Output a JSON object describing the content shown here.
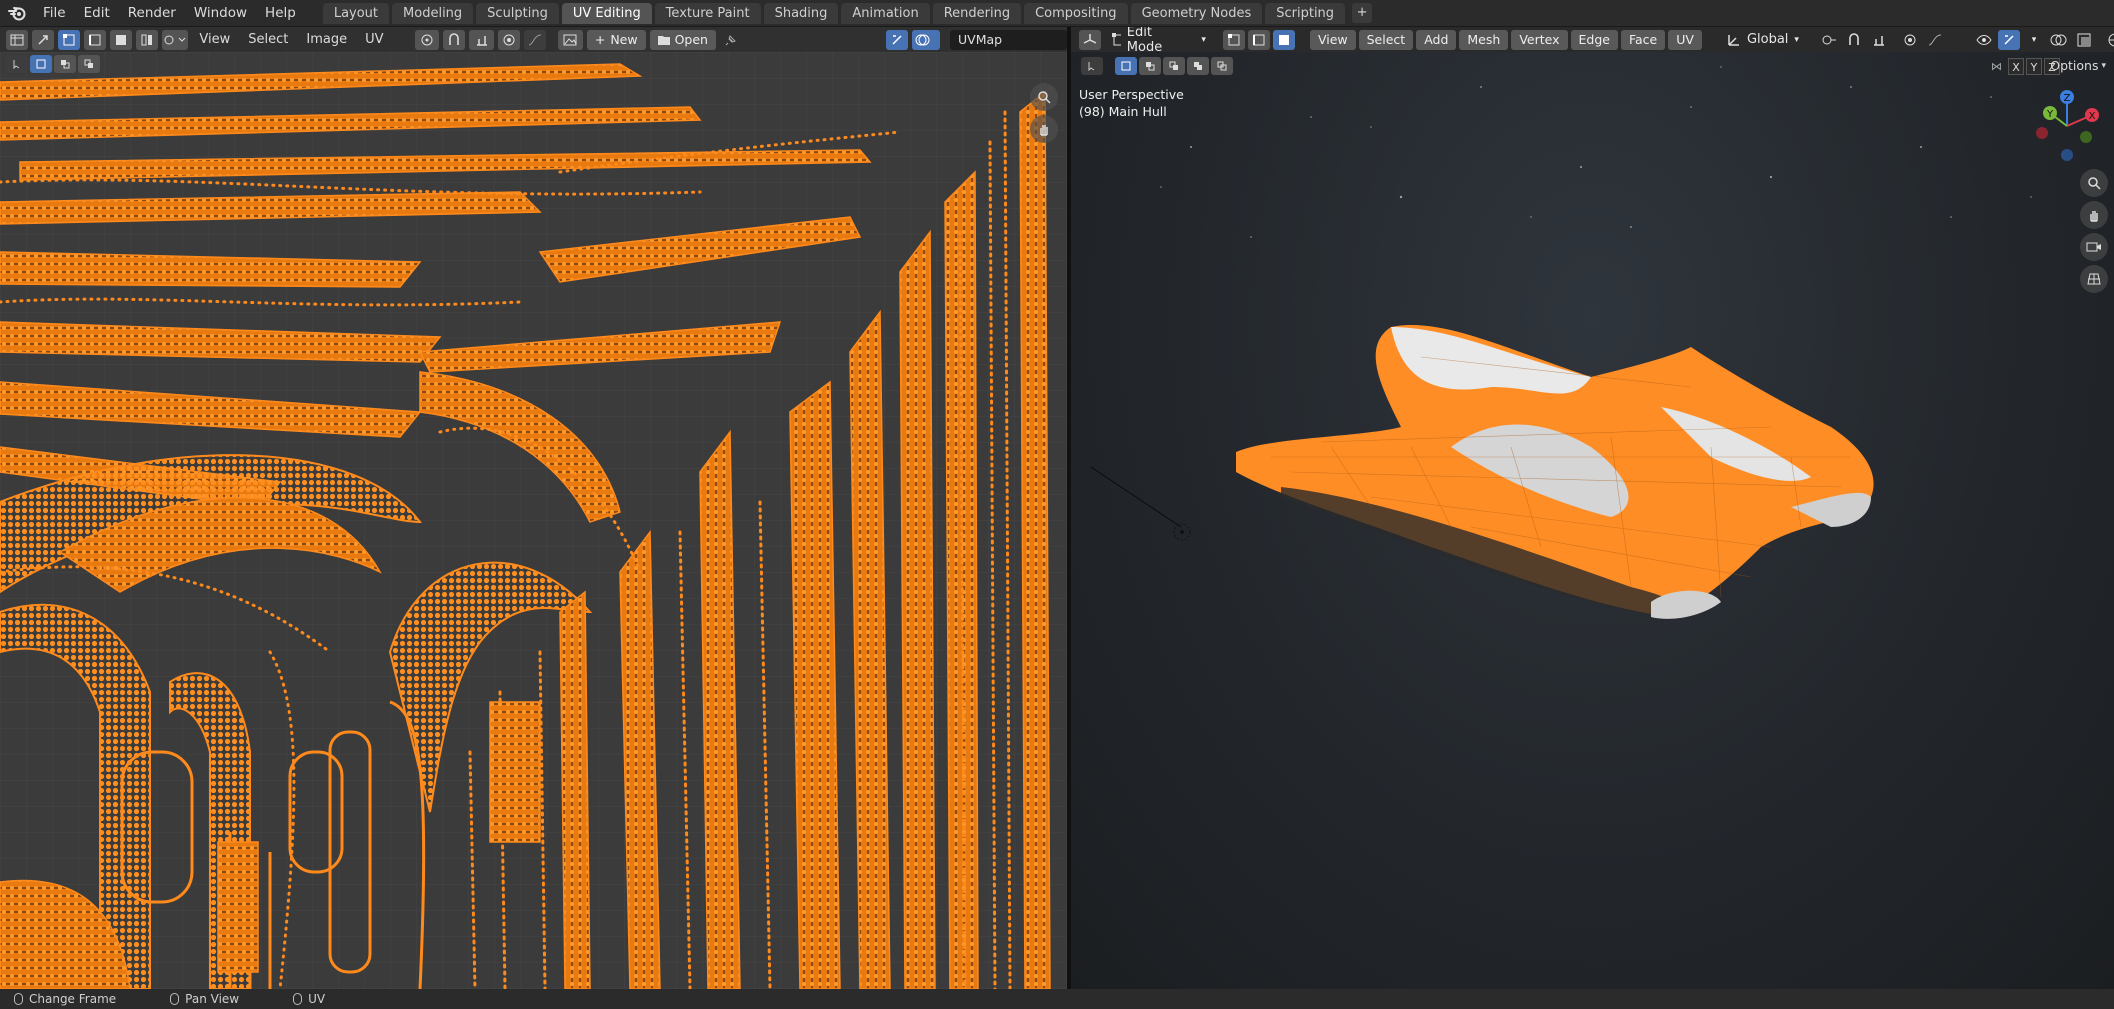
{
  "app": {
    "menu": [
      "File",
      "Edit",
      "Render",
      "Window",
      "Help"
    ],
    "workspace_tabs": [
      "Layout",
      "Modeling",
      "Sculpting",
      "UV Editing",
      "Texture Paint",
      "Shading",
      "Animation",
      "Rendering",
      "Compositing",
      "Geometry Nodes",
      "Scripting"
    ],
    "active_tab": "UV Editing",
    "add_tab_label": "+"
  },
  "uv_editor": {
    "menus": [
      "View",
      "Select",
      "Image",
      "UV"
    ],
    "new_label": "New",
    "open_label": "Open",
    "uvmap_value": "UVMap",
    "accent_color": "#ff8a1c"
  },
  "viewport": {
    "mode": "Edit Mode",
    "menus": [
      "View",
      "Select",
      "Add",
      "Mesh",
      "Vertex",
      "Edge",
      "Face",
      "UV"
    ],
    "orientation": "Global",
    "axis_buttons": [
      "X",
      "Y",
      "Z"
    ],
    "options_label": "Options",
    "overlay_line1": "User Perspective",
    "overlay_line2": "(98) Main Hull",
    "gizmo_axes": {
      "z": "Z",
      "y": "Y",
      "x": "X"
    }
  },
  "statusbar": {
    "items": [
      "Change Frame",
      "Pan View",
      "UV"
    ]
  }
}
